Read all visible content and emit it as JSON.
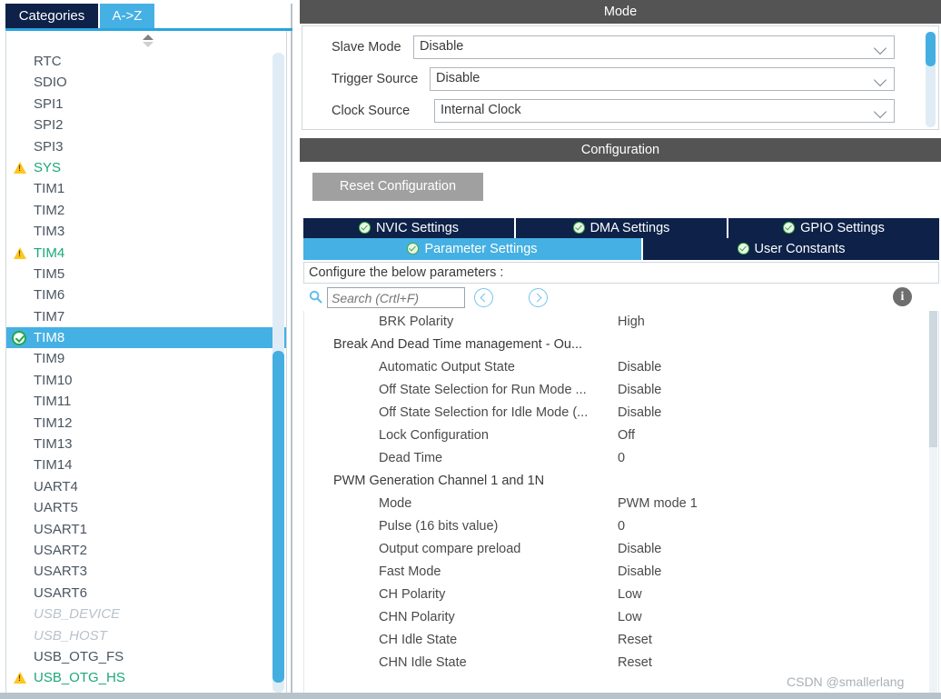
{
  "left_panel": {
    "tabs": [
      {
        "label": "Categories",
        "active": false
      },
      {
        "label": "A->Z",
        "active": true
      }
    ],
    "peripherals": [
      {
        "label": "RTC",
        "state": "normal"
      },
      {
        "label": "SDIO",
        "state": "normal"
      },
      {
        "label": "SPI1",
        "state": "normal"
      },
      {
        "label": "SPI2",
        "state": "normal"
      },
      {
        "label": "SPI3",
        "state": "normal"
      },
      {
        "label": "SYS",
        "state": "warning"
      },
      {
        "label": "TIM1",
        "state": "normal"
      },
      {
        "label": "TIM2",
        "state": "normal"
      },
      {
        "label": "TIM3",
        "state": "normal"
      },
      {
        "label": "TIM4",
        "state": "warning"
      },
      {
        "label": "TIM5",
        "state": "normal"
      },
      {
        "label": "TIM6",
        "state": "normal"
      },
      {
        "label": "TIM7",
        "state": "normal"
      },
      {
        "label": "TIM8",
        "state": "selected"
      },
      {
        "label": "TIM9",
        "state": "normal"
      },
      {
        "label": "TIM10",
        "state": "normal"
      },
      {
        "label": "TIM11",
        "state": "normal"
      },
      {
        "label": "TIM12",
        "state": "normal"
      },
      {
        "label": "TIM13",
        "state": "normal"
      },
      {
        "label": "TIM14",
        "state": "normal"
      },
      {
        "label": "UART4",
        "state": "normal"
      },
      {
        "label": "UART5",
        "state": "normal"
      },
      {
        "label": "USART1",
        "state": "normal"
      },
      {
        "label": "USART2",
        "state": "normal"
      },
      {
        "label": "USART3",
        "state": "normal"
      },
      {
        "label": "USART6",
        "state": "normal"
      },
      {
        "label": "USB_DEVICE",
        "state": "disabled"
      },
      {
        "label": "USB_HOST",
        "state": "disabled"
      },
      {
        "label": "USB_OTG_FS",
        "state": "normal"
      },
      {
        "label": "USB_OTG_HS",
        "state": "warning"
      }
    ]
  },
  "mode": {
    "title": "Mode",
    "rows": [
      {
        "label": "Slave Mode",
        "value": "Disable"
      },
      {
        "label": "Trigger Source",
        "value": "Disable"
      },
      {
        "label": "Clock Source",
        "value": "Internal Clock"
      },
      {
        "label": "",
        "value": ""
      }
    ]
  },
  "configuration": {
    "title": "Configuration",
    "reset_button": "Reset Configuration",
    "tabs_top": [
      {
        "label": "NVIC Settings",
        "active": false
      },
      {
        "label": "DMA Settings",
        "active": false
      },
      {
        "label": "GPIO Settings",
        "active": false
      }
    ],
    "tabs_bottom": [
      {
        "label": "Parameter Settings",
        "active": true
      },
      {
        "label": "User Constants",
        "active": false
      }
    ],
    "note": "Configure the below parameters :",
    "search_placeholder": "Search (Crtl+F)",
    "search_value": "",
    "parameters": [
      {
        "type": "param",
        "key": "BRK Polarity",
        "value": "High"
      },
      {
        "type": "group",
        "key": "Break And Dead Time management - Ou...",
        "value": ""
      },
      {
        "type": "param",
        "key": "Automatic Output State",
        "value": "Disable"
      },
      {
        "type": "param",
        "key": "Off State Selection for Run Mode ...",
        "value": "Disable"
      },
      {
        "type": "param",
        "key": "Off State Selection for Idle Mode (...",
        "value": "Disable"
      },
      {
        "type": "param",
        "key": "Lock Configuration",
        "value": "Off"
      },
      {
        "type": "param",
        "key": "Dead Time",
        "value": "0"
      },
      {
        "type": "group",
        "key": "PWM Generation Channel 1 and 1N",
        "value": ""
      },
      {
        "type": "param",
        "key": "Mode",
        "value": "PWM mode 1"
      },
      {
        "type": "param",
        "key": "Pulse (16 bits value)",
        "value": "0"
      },
      {
        "type": "param",
        "key": "Output compare preload",
        "value": "Disable"
      },
      {
        "type": "param",
        "key": "Fast Mode",
        "value": "Disable"
      },
      {
        "type": "param",
        "key": "CH Polarity",
        "value": "Low"
      },
      {
        "type": "param",
        "key": "CHN Polarity",
        "value": "Low"
      },
      {
        "type": "param",
        "key": "CH Idle State",
        "value": "Reset"
      },
      {
        "type": "param",
        "key": "CHN Idle State",
        "value": "Reset"
      }
    ]
  },
  "watermark": "CSDN @smallerlang",
  "colors": {
    "tab_navy": "#0d2149",
    "tab_active_blue": "#45b0e3",
    "header_gray": "#545454",
    "selection_blue": "#45b0e3",
    "warning_yellow": "#ffc61e",
    "check_green": "#21a84a",
    "scrollbar_blue": "#45aee0"
  }
}
